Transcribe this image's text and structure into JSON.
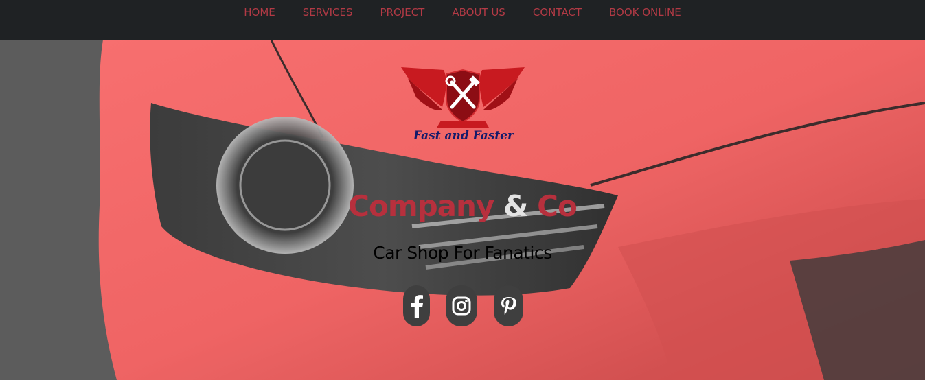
{
  "nav": {
    "items": [
      {
        "label": "HOME"
      },
      {
        "label": "SERVICES"
      },
      {
        "label": "PROJECT"
      },
      {
        "label": "ABOUT US"
      },
      {
        "label": "CONTACT"
      },
      {
        "label": "BOOK ONLINE"
      }
    ]
  },
  "logo": {
    "text": "Fast and Faster",
    "icon": "wrench-hammer-shield-icon"
  },
  "hero": {
    "company_name": "Company",
    "ampersand": "&",
    "company_suffix": "Co",
    "tagline": "Car Shop For Fanatics"
  },
  "social": [
    {
      "icon": "facebook-icon"
    },
    {
      "icon": "instagram-icon"
    },
    {
      "icon": "pinterest-icon"
    }
  ],
  "colors": {
    "nav_bg": "#1f2224",
    "nav_text": "#b23a45",
    "brand_red": "#b7303d",
    "car_red": "#f06464",
    "social_bg": "#3f3f3f"
  }
}
